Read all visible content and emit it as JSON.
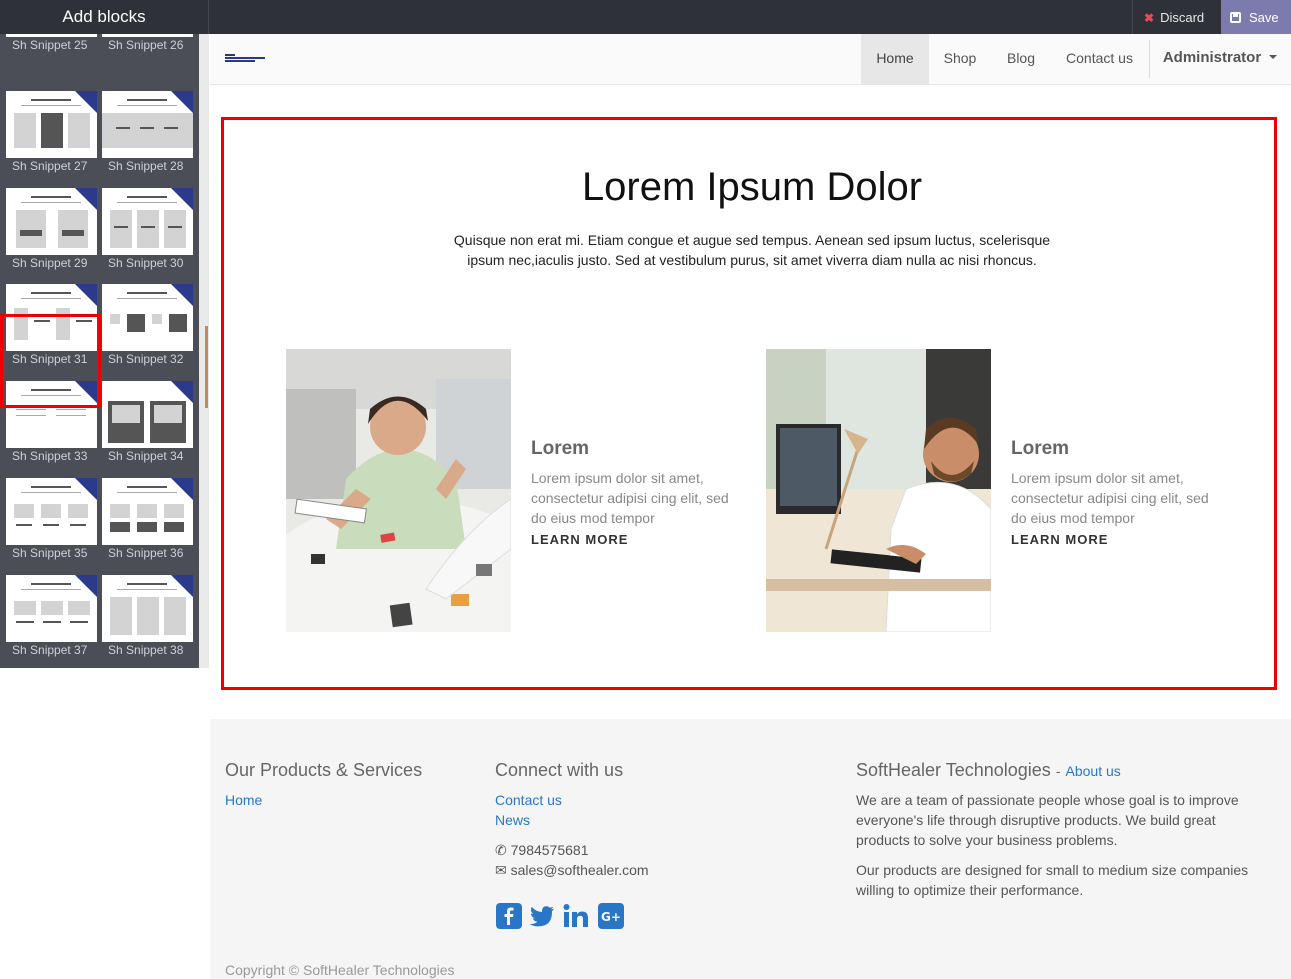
{
  "editor": {
    "panel_title": "Add blocks",
    "discard_label": "Discard",
    "save_label": "Save",
    "colors": {
      "bar": "#2f3138",
      "save": "#7c7bad",
      "selection": "#ee0000"
    }
  },
  "snippets": [
    {
      "label": "Sh Snippet 25"
    },
    {
      "label": "Sh Snippet 26"
    },
    {
      "label": "Sh Snippet 27"
    },
    {
      "label": "Sh Snippet 28"
    },
    {
      "label": "Sh Snippet 29"
    },
    {
      "label": "Sh Snippet 30"
    },
    {
      "label": "Sh Snippet 31"
    },
    {
      "label": "Sh Snippet 32"
    },
    {
      "label": "Sh Snippet 33"
    },
    {
      "label": "Sh Snippet 34"
    },
    {
      "label": "Sh Snippet 35"
    },
    {
      "label": "Sh Snippet 36"
    },
    {
      "label": "Sh Snippet 37"
    },
    {
      "label": "Sh Snippet 38"
    }
  ],
  "selected_snippet": "Sh Snippet 31",
  "nav": {
    "items": [
      "Home",
      "Shop",
      "Blog",
      "Contact us"
    ],
    "active": "Home",
    "user": "Administrator"
  },
  "hero": {
    "title": "Lorem Ipsum Dolor",
    "text": "Quisque non erat mi. Etiam congue et augue sed tempus. Aenean sed ipsum luctus, scelerisque ipsum nec,iaculis justo. Sed at vestibulum purus, sit amet viverra diam nulla ac nisi rhoncus."
  },
  "cards": [
    {
      "heading": "Lorem",
      "text": "Lorem ipsum dolor sit amet, consectetur adipisi cing elit, sed do eius mod tempor",
      "link": "LEARN MORE"
    },
    {
      "heading": "Lorem",
      "text": "Lorem ipsum dolor sit amet, consectetur adipisi cing elit, sed do eius mod tempor",
      "link": "LEARN MORE"
    }
  ],
  "footer": {
    "col1_title": "Our Products & Services",
    "col1_links": [
      "Home"
    ],
    "col2_title": "Connect with us",
    "col2_links": [
      "Contact us",
      "News"
    ],
    "phone": "7984575681",
    "email": "sales@softhealer.com",
    "col3_title": "SoftHealer Technologies",
    "col3_sep": "-",
    "col3_about": "About us",
    "about_p1": "We are a team of passionate people whose goal is to improve everyone's life through disruptive products. We build great products to solve your business problems.",
    "about_p2": "Our products are designed for small to medium size companies willing to optimize their performance.",
    "copyright": "Copyright © SoftHealer Technologies",
    "social_icons": [
      "facebook-icon",
      "twitter-icon",
      "linkedin-icon",
      "google-plus-icon"
    ],
    "link_color": "#2a76c6"
  }
}
